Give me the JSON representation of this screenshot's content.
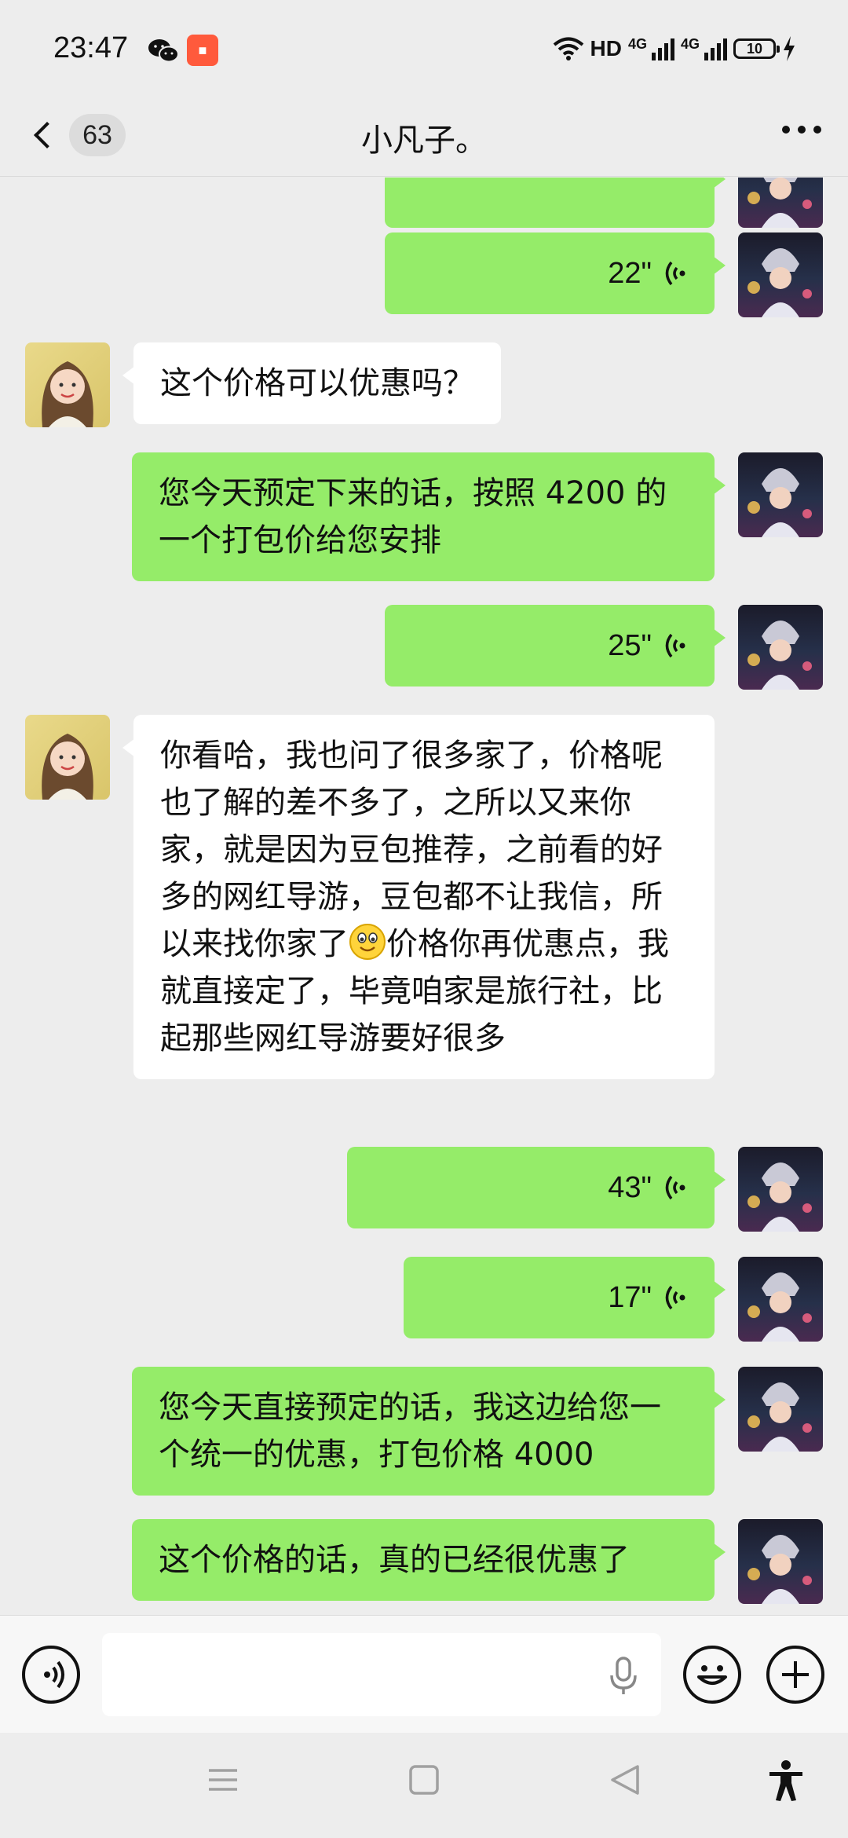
{
  "status_bar": {
    "time": "23:47",
    "network": "HD",
    "sim1": "4G",
    "sim2": "4G",
    "battery": "10"
  },
  "header": {
    "unread_count": "63",
    "title": "小凡子。"
  },
  "messages": [
    {
      "side": "out",
      "type": "voice",
      "duration": "",
      "partial": true
    },
    {
      "side": "out",
      "type": "voice",
      "duration": "22\""
    },
    {
      "side": "in",
      "type": "text",
      "text": "这个价格可以优惠吗？"
    },
    {
      "side": "out",
      "type": "text",
      "text": "您今天预定下来的话，按照 4200 的一个打包价给您安排"
    },
    {
      "side": "out",
      "type": "voice",
      "duration": "25\""
    },
    {
      "side": "in",
      "type": "text",
      "text_part1": "你看哈，我也问了很多家了，价格呢也了解的差不多了，之所以又来你家，就是因为豆包推荐，之前看的好多的网红导游，豆包都不让我信，所以来找你家了",
      "emoji": "smile-emoji",
      "text_part2": "价格你再优惠点，我就直接定了，毕竟咱家是旅行社，比起那些网红导游要好很多"
    },
    {
      "side": "out",
      "type": "voice",
      "duration": "43\""
    },
    {
      "side": "out",
      "type": "voice",
      "duration": "17\""
    },
    {
      "side": "out",
      "type": "text",
      "text": "您今天直接预定的话，我这边给您一个统一的优惠，打包价格 4000"
    },
    {
      "side": "out",
      "type": "text",
      "text": "这个价格的话，真的已经很优惠了"
    }
  ],
  "input_bar": {
    "placeholder": ""
  },
  "colors": {
    "outgoing_bubble": "#95ec69",
    "incoming_bubble": "#ffffff",
    "background": "#ededed"
  },
  "icons": [
    "wechat-icon",
    "app-notification-icon",
    "wifi-icon",
    "signal-icon",
    "battery-icon",
    "charging-icon",
    "voice-wave-icon",
    "voice-mode-icon",
    "microphone-icon",
    "emoji-icon",
    "plus-icon",
    "menu-icon",
    "home-icon",
    "back-triangle-icon",
    "accessibility-icon"
  ]
}
